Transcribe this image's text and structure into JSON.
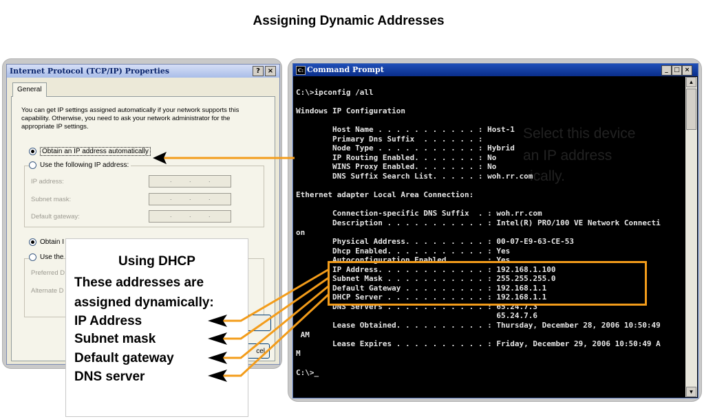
{
  "title": "Assigning Dynamic Addresses",
  "dialog": {
    "title": "Internet Protocol (TCP/IP) Properties",
    "help_btn": "?",
    "close_btn": "×",
    "tab": "General",
    "description": "You can get IP settings assigned automatically if your network supports this capability. Otherwise, you need to ask your network administrator for the appropriate IP settings.",
    "radio_auto_ip": "Obtain an IP address automatically",
    "radio_manual_ip": "Use the following IP address:",
    "ip_label": "IP address:",
    "subnet_label": "Subnet mask:",
    "gateway_label": "Default gateway:",
    "radio_auto_dns": "Obtain I",
    "radio_manual_dns": "Use the",
    "pref_dns": "Preferred D",
    "alt_dns": "Alternate D",
    "cancel_partial": "cel"
  },
  "callout": {
    "heading": "Using DHCP",
    "line1": "These addresses are",
    "line2": "assigned dynamically:",
    "items": [
      "IP Address",
      "Subnet mask",
      "Default gateway",
      "DNS server"
    ]
  },
  "cmd": {
    "title": "Command Prompt",
    "lines": [
      "C:\\>ipconfig /all",
      "",
      "Windows IP Configuration",
      "",
      "        Host Name . . . . . . . . . . . : Host-1",
      "        Primary Dns Suffix  . . . . . . :",
      "        Node Type . . . . . . . . . . . : Hybrid",
      "        IP Routing Enabled. . . . . . . : No",
      "        WINS Proxy Enabled. . . . . . . : No",
      "        DNS Suffix Search List. . . . . : woh.rr.com",
      "",
      "Ethernet adapter Local Area Connection:",
      "",
      "        Connection-specific DNS Suffix  . : woh.rr.com",
      "        Description . . . . . . . . . . . : Intel(R) PRO/100 VE Network Connecti",
      "on",
      "        Physical Address. . . . . . . . . : 00-07-E9-63-CE-53",
      "        Dhcp Enabled. . . . . . . . . . . : Yes",
      "        Autoconfiguration Enabled . . . . : Yes",
      "        IP Address. . . . . . . . . . . . : 192.168.1.100",
      "        Subnet Mask . . . . . . . . . . . : 255.255.255.0",
      "        Default Gateway . . . . . . . . . : 192.168.1.1",
      "        DHCP Server . . . . . . . . . . . : 192.168.1.1",
      "        DNS Servers . . . . . . . . . . . : 65.24.7.3",
      "                                            65.24.7.6",
      "        Lease Obtained. . . . . . . . . . : Thursday, December 28, 2006 10:50:49",
      " AM",
      "        Lease Expires . . . . . . . . . . : Friday, December 29, 2006 10:50:49 A",
      "M",
      "",
      "C:\\>_"
    ],
    "ghost": [
      "Select this device",
      "an IP address",
      "ically."
    ]
  },
  "colors": {
    "accent": "#f39c1a"
  }
}
